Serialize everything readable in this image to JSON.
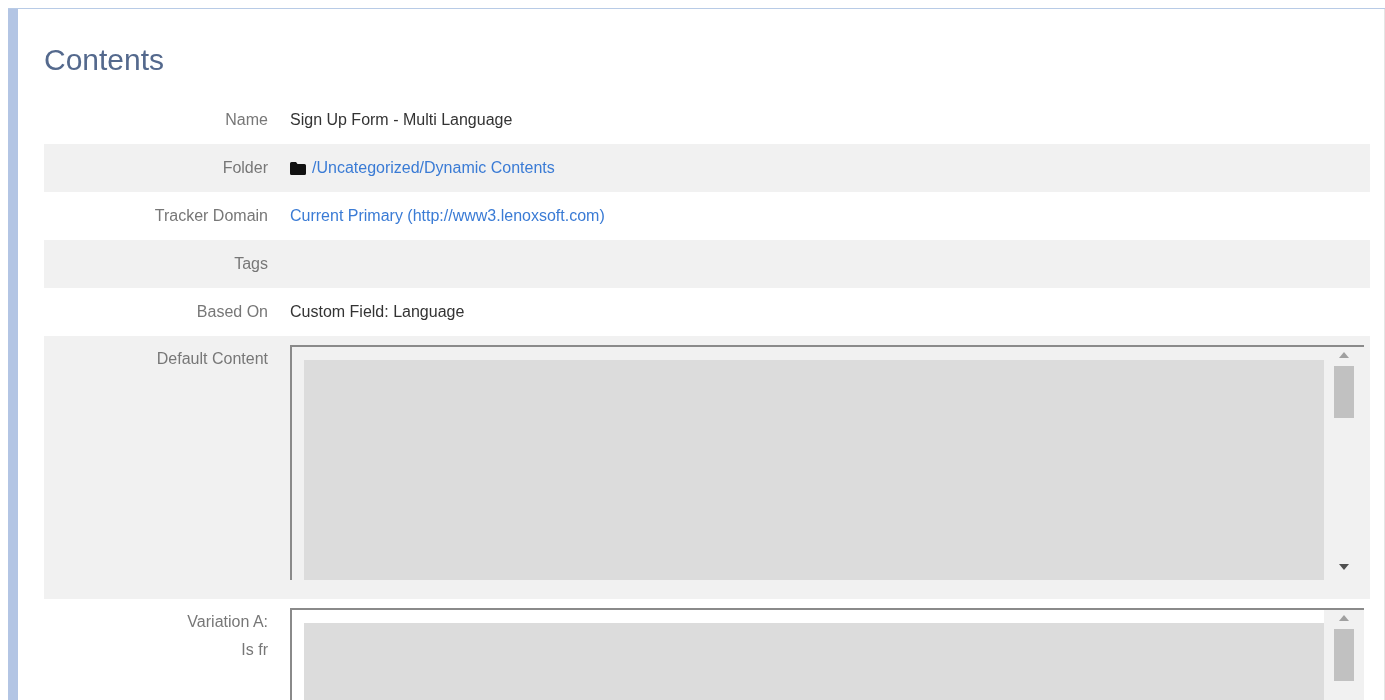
{
  "title": "Contents",
  "fields": [
    {
      "kind": "text",
      "label": "Name",
      "value": "Sign Up Form - Multi Language"
    },
    {
      "kind": "folder",
      "label": "Folder",
      "value": "/Uncategorized/Dynamic Contents"
    },
    {
      "kind": "link",
      "label": "Tracker Domain",
      "value": "Current Primary (http://www3.lenoxsoft.com)"
    },
    {
      "kind": "empty",
      "label": "Tags"
    },
    {
      "kind": "text",
      "label": "Based On",
      "value": "Custom Field: Language"
    },
    {
      "kind": "textarea",
      "label": "Default Content"
    },
    {
      "kind": "textarea",
      "label": "Variation A:",
      "sublabel": "Is fr"
    }
  ]
}
